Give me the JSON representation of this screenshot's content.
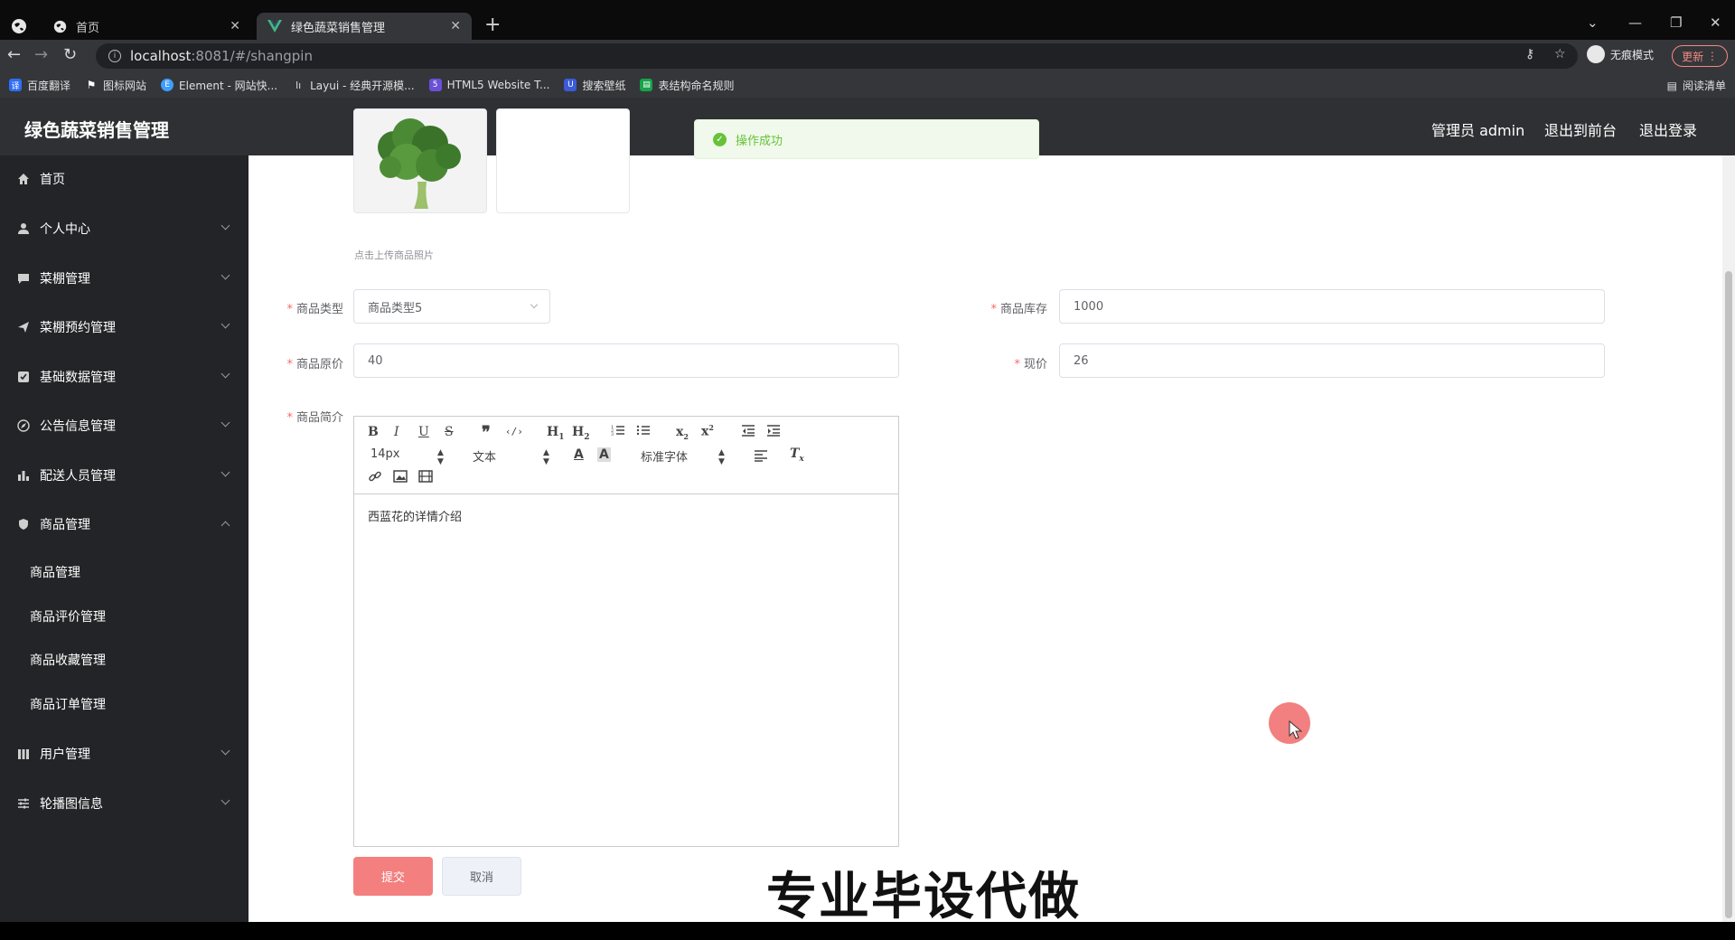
{
  "browser": {
    "tabs": [
      {
        "title": "首页",
        "active": false
      },
      {
        "title": "绿色蔬菜销售管理",
        "active": true
      }
    ],
    "url_host": "localhost",
    "url_path": ":8081/#/shangpin",
    "profile_label": "无痕模式",
    "update_label": "更新",
    "bookmarks": [
      {
        "label": "百度翻译",
        "icon": "translate-icon",
        "color": "#2f6df6"
      },
      {
        "label": "图标网站",
        "icon": "flag-icon",
        "color": "#555555"
      },
      {
        "label": "Element - 网站快...",
        "icon": "element-logo-icon",
        "color": "#409eff"
      },
      {
        "label": "Layui - 经典开源模...",
        "icon": "layui-logo-icon",
        "color": "#777777"
      },
      {
        "label": "HTML5 Website T...",
        "icon": "html5-logo-icon",
        "color": "#6b4fd8"
      },
      {
        "label": "搜索壁纸",
        "icon": "wallpaper-icon",
        "color": "#3b5bdb"
      },
      {
        "label": "表结构命名规则",
        "icon": "sheet-icon",
        "color": "#16a34a"
      }
    ],
    "reading_list_label": "阅读清单"
  },
  "header": {
    "title": "绿色蔬菜销售管理",
    "user_label": "管理员 admin",
    "front_link": "退出到前台",
    "logout_link": "退出登录"
  },
  "toast": {
    "message": "操作成功"
  },
  "sidebar": {
    "items": [
      {
        "label": "首页",
        "icon": "home-icon",
        "expandable": false
      },
      {
        "label": "个人中心",
        "icon": "user-icon",
        "expandable": true
      },
      {
        "label": "菜棚管理",
        "icon": "message-icon",
        "expandable": true
      },
      {
        "label": "菜棚预约管理",
        "icon": "send-icon",
        "expandable": true
      },
      {
        "label": "基础数据管理",
        "icon": "check-square-icon",
        "expandable": true
      },
      {
        "label": "公告信息管理",
        "icon": "compass-icon",
        "expandable": true
      },
      {
        "label": "配送人员管理",
        "icon": "bar-chart-icon",
        "expandable": true
      },
      {
        "label": "商品管理",
        "icon": "shield-icon",
        "expandable": true,
        "expanded": true
      },
      {
        "label": "用户管理",
        "icon": "columns-icon",
        "expandable": true
      },
      {
        "label": "轮播图信息",
        "icon": "sliders-icon",
        "expandable": true
      }
    ],
    "sub_items": [
      "商品管理",
      "商品评价管理",
      "商品收藏管理",
      "商品订单管理"
    ]
  },
  "form": {
    "upload_hint": "点击上传商品照片",
    "type_label": "商品类型",
    "type_value": "商品类型5",
    "stock_label": "商品库存",
    "stock_value": "1000",
    "original_price_label": "商品原价",
    "original_price_value": "40",
    "current_price_label": "现价",
    "current_price_value": "26",
    "intro_label": "商品简介",
    "editor": {
      "font_size": "14px",
      "text_style": "文本",
      "font_family": "标准字体",
      "content": "西蓝花的详情介绍"
    },
    "submit_label": "提交",
    "cancel_label": "取消"
  },
  "watermark": "专业毕设代做",
  "colors": {
    "header_bg": "#2f3033",
    "sidebar_bg": "#232427",
    "submit_bg": "#f47f7f",
    "success": "#67c23a"
  }
}
